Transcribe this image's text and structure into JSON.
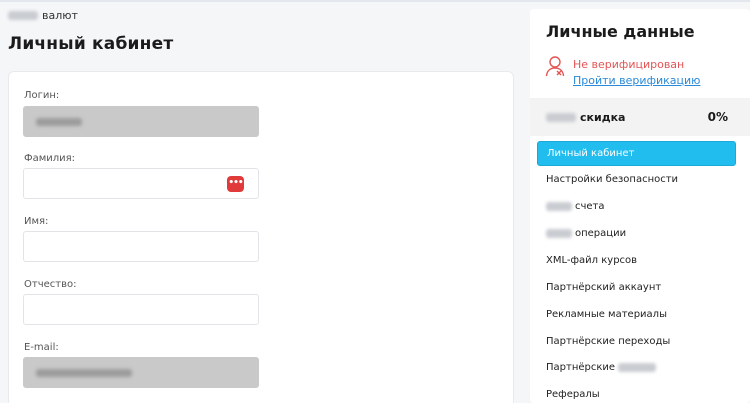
{
  "breadcrumb": {
    "text": "валют"
  },
  "page": {
    "title": "Личный кабинет"
  },
  "form": {
    "fields": [
      {
        "label": "Логин:",
        "readonly": true
      },
      {
        "label": "Фамилия:",
        "readonly": false
      },
      {
        "label": "Имя:",
        "readonly": false
      },
      {
        "label": "Отчество:",
        "readonly": false
      },
      {
        "label": "E-mail:",
        "readonly": true
      }
    ],
    "password_manager_icon": "dots-icon"
  },
  "sidebar": {
    "title": "Личные данные",
    "verification": {
      "status": "Не верифицирован",
      "link": "Пройти верификацию",
      "icon": "user-icon",
      "accent": "#e45555",
      "link_color": "#2a89d8"
    },
    "discount": {
      "label": "скидка",
      "value": "0%"
    },
    "menu": [
      {
        "label": "Личный кабинет",
        "active": true
      },
      {
        "label": "Настройки безопасности"
      },
      {
        "label": "счета"
      },
      {
        "label": "операции"
      },
      {
        "label": "XML-файл курсов"
      },
      {
        "label": "Партнёрский аккаунт"
      },
      {
        "label": "Рекламные материалы"
      },
      {
        "label": "Партнёрские переходы"
      },
      {
        "label": "Партнёрские"
      },
      {
        "label": "Рефералы"
      }
    ],
    "active_color": "#22bdef"
  }
}
